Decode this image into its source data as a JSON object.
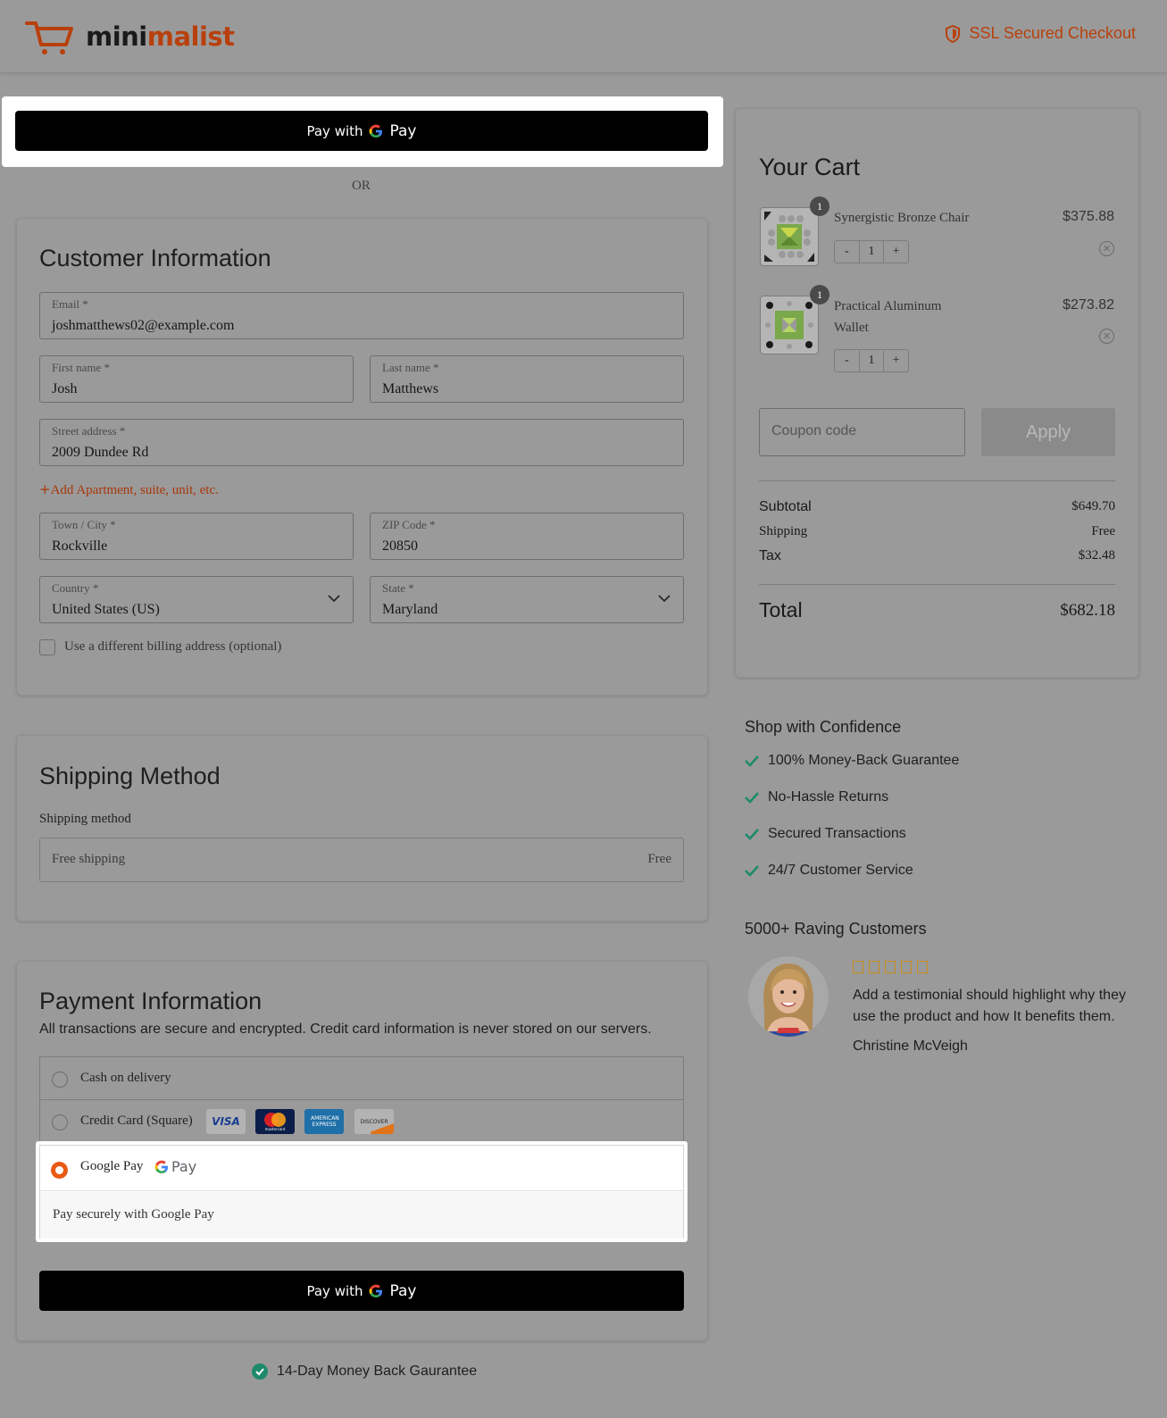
{
  "header": {
    "brand_part1": "mini",
    "brand_part2": "malist",
    "ssl_text": "SSL Secured Checkout"
  },
  "express": {
    "pay_with": "Pay with",
    "gpay_g": "G",
    "gpay_word": "Pay",
    "or": "OR"
  },
  "customer": {
    "title": "Customer Information",
    "email": {
      "label": "Email *",
      "value": "joshmatthews02@example.com"
    },
    "first_name": {
      "label": "First name *",
      "value": "Josh"
    },
    "last_name": {
      "label": "Last name *",
      "value": "Matthews"
    },
    "street": {
      "label": "Street address *",
      "value": "2009 Dundee Rd"
    },
    "add_apartment": "Add Apartment, suite, unit, etc.",
    "town": {
      "label": "Town / City *",
      "value": "Rockville"
    },
    "zip": {
      "label": "ZIP Code *",
      "value": "20850"
    },
    "country": {
      "label": "Country *",
      "value": "United States (US)"
    },
    "state": {
      "label": "State *",
      "value": "Maryland"
    },
    "billing_checkbox": "Use a different billing address (optional)"
  },
  "shipping": {
    "title": "Shipping Method",
    "label": "Shipping method",
    "option": "Free shipping",
    "price": "Free"
  },
  "payment": {
    "title": "Payment Information",
    "description": "All transactions are secure and encrypted. Credit card information is never stored on our servers.",
    "methods": [
      {
        "label": "Cash on delivery"
      },
      {
        "label": "Credit Card (Square)"
      },
      {
        "label": "Google Pay"
      }
    ],
    "card_icons": [
      "VISA",
      "mastercard",
      "AMERICAN EXPRESS",
      "DISCOVER"
    ],
    "gpay_description": "Pay securely with Google Pay",
    "pay_with": "Pay with",
    "gpay_g": "G",
    "gpay_word": "Pay"
  },
  "guarantee": "14-Day Money Back Gaurantee",
  "cart": {
    "title": "Your Cart",
    "items": [
      {
        "name": "Synergistic Bronze Chair",
        "price": "$375.88",
        "qty": "1",
        "badge": "1"
      },
      {
        "name": "Practical Aluminum Wallet",
        "price": "$273.82",
        "qty": "1",
        "badge": "1"
      }
    ],
    "qty_minus": "-",
    "qty_plus": "+",
    "coupon_placeholder": "Coupon code",
    "apply": "Apply",
    "subtotal_label": "Subtotal",
    "subtotal": "$649.70",
    "shipping_label": "Shipping",
    "shipping": "Free",
    "tax_label": "Tax",
    "tax": "$32.48",
    "total_label": "Total",
    "total": "$682.18"
  },
  "confidence": {
    "title": "Shop with Confidence",
    "items": [
      "100% Money-Back Guarantee",
      "No-Hassle Returns",
      "Secured Transactions",
      "24/7 Customer Service"
    ]
  },
  "testimonial": {
    "title": "5000+ Raving Customers",
    "rating": 5,
    "text": "Add a testimonial should highlight why they use the product and how It benefits them.",
    "name": "Christine McVeigh"
  },
  "colors": {
    "accent": "#b8400c",
    "check": "#1e8a6a",
    "radio_selected": "#e95a15"
  }
}
